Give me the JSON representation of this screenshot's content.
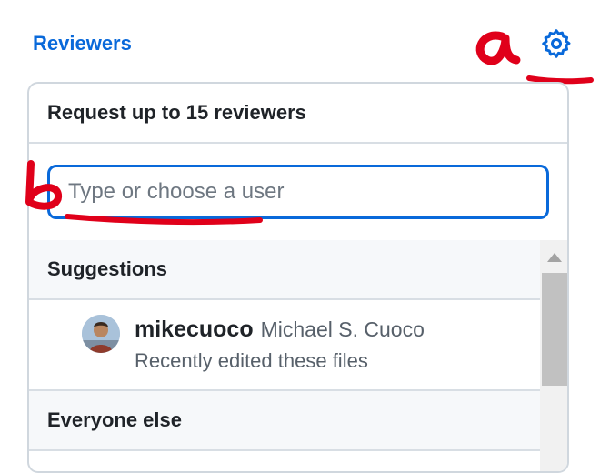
{
  "header": {
    "title": "Reviewers",
    "settings_icon": "gear-icon"
  },
  "annotations": {
    "a": "a",
    "b": "b"
  },
  "panel": {
    "title": "Request up to 15 reviewers",
    "filter": {
      "placeholder": "Type or choose a user",
      "value": ""
    },
    "sections": {
      "suggestions": "Suggestions",
      "everyone_else": "Everyone else"
    },
    "suggested_user": {
      "login": "mikecuoco",
      "name": "Michael S. Cuoco",
      "description": "Recently edited these files"
    }
  },
  "colors": {
    "link": "#0969da",
    "annotation": "#e0001a"
  }
}
